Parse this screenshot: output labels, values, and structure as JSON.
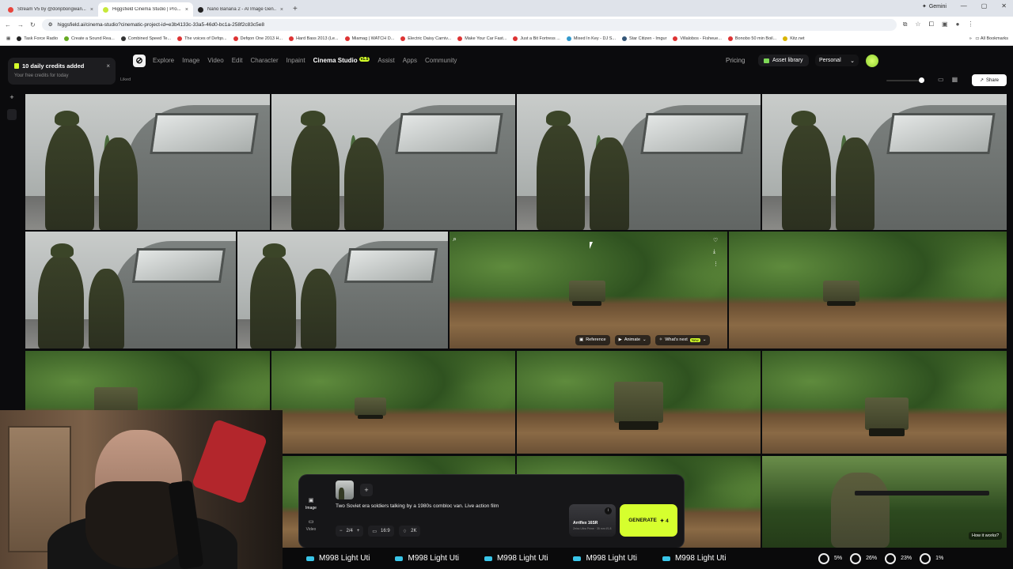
{
  "browser": {
    "tabs": [
      {
        "title": "Stream V5 by @donpbongwan...",
        "color": "#e8453c",
        "active": false
      },
      {
        "title": "Higgsfield Cinema Studio | Pro...",
        "color": "#c7e83a",
        "active": true
      },
      {
        "title": "Nano Banana 2 - AI Image Gen...",
        "color": "#222222",
        "active": false
      }
    ],
    "new_tab": "+",
    "gemini": "Gemini",
    "url": "higgsfield.ai/cinema-studio?cinematic-project-id=e3b4133c-33a5-46d0-bc1a-258f2c83c5e8",
    "bookmarks": [
      "Task Force Radio",
      "Create a Sound Rea...",
      "Combined Speed Te...",
      "The voices of Defqo...",
      "Defqon One 2013 H...",
      "Hard Bass 2013 (Le...",
      "Miamag | WATCH D...",
      "Electric Daisy Carniv...",
      "Make Your Car Fast...",
      "Just a Bit Fortress ...",
      "Mixed In Key - DJ S...",
      "Star Citizen - Imgur",
      "Villalobos - Fisheue...",
      "Bonobo 50 min Boil...",
      "Kitz.net"
    ],
    "all_bookmarks": "All Bookmarks"
  },
  "nav": {
    "links": [
      "Explore",
      "Image",
      "Video",
      "Edit",
      "Character",
      "Inpaint"
    ],
    "active": "Cinema Studio",
    "active_badge": "v1.5",
    "links_after": [
      "Assist",
      "Apps",
      "Community"
    ],
    "pricing": "Pricing",
    "asset_library": "Asset library",
    "workspace": "Personal"
  },
  "toast": {
    "title": "10 daily credits added",
    "subtitle": "Your free credits for today",
    "close": "×"
  },
  "liked": "Liked",
  "share": "Share",
  "tile_actions": {
    "reference": "Reference",
    "animate": "Animate",
    "whats_next": "What's next",
    "new_badge": "New"
  },
  "prompt": {
    "modes": [
      {
        "label": "Image",
        "active": true
      },
      {
        "label": "Video",
        "active": false
      }
    ],
    "add": "+",
    "text": "Two Soviet era soldiers talking by a 1980s combloc van. Live action film",
    "count": "2/4",
    "minus": "−",
    "plus": "+",
    "ratio": "16:9",
    "quality": "2K",
    "camera_name": "Arriflex 16SR",
    "camera_sub": "Zeiss Ultra Prime · 35 mm f/1.8",
    "generate": "GENERATE",
    "generate_cost": "✦ 4"
  },
  "how_it_works": "How it works?",
  "ticker": [
    "M998 Light Uti",
    "M998 Light Uti",
    "M998 Light Uti",
    "M998 Light Uti",
    "M998 Light Uti"
  ],
  "stats": [
    {
      "icon": "cpu-icon",
      "value": "5%"
    },
    {
      "icon": "gpu-icon",
      "value": "26%"
    },
    {
      "icon": "ram-icon",
      "value": "23%"
    },
    {
      "icon": "disk-icon",
      "value": "1%"
    }
  ]
}
